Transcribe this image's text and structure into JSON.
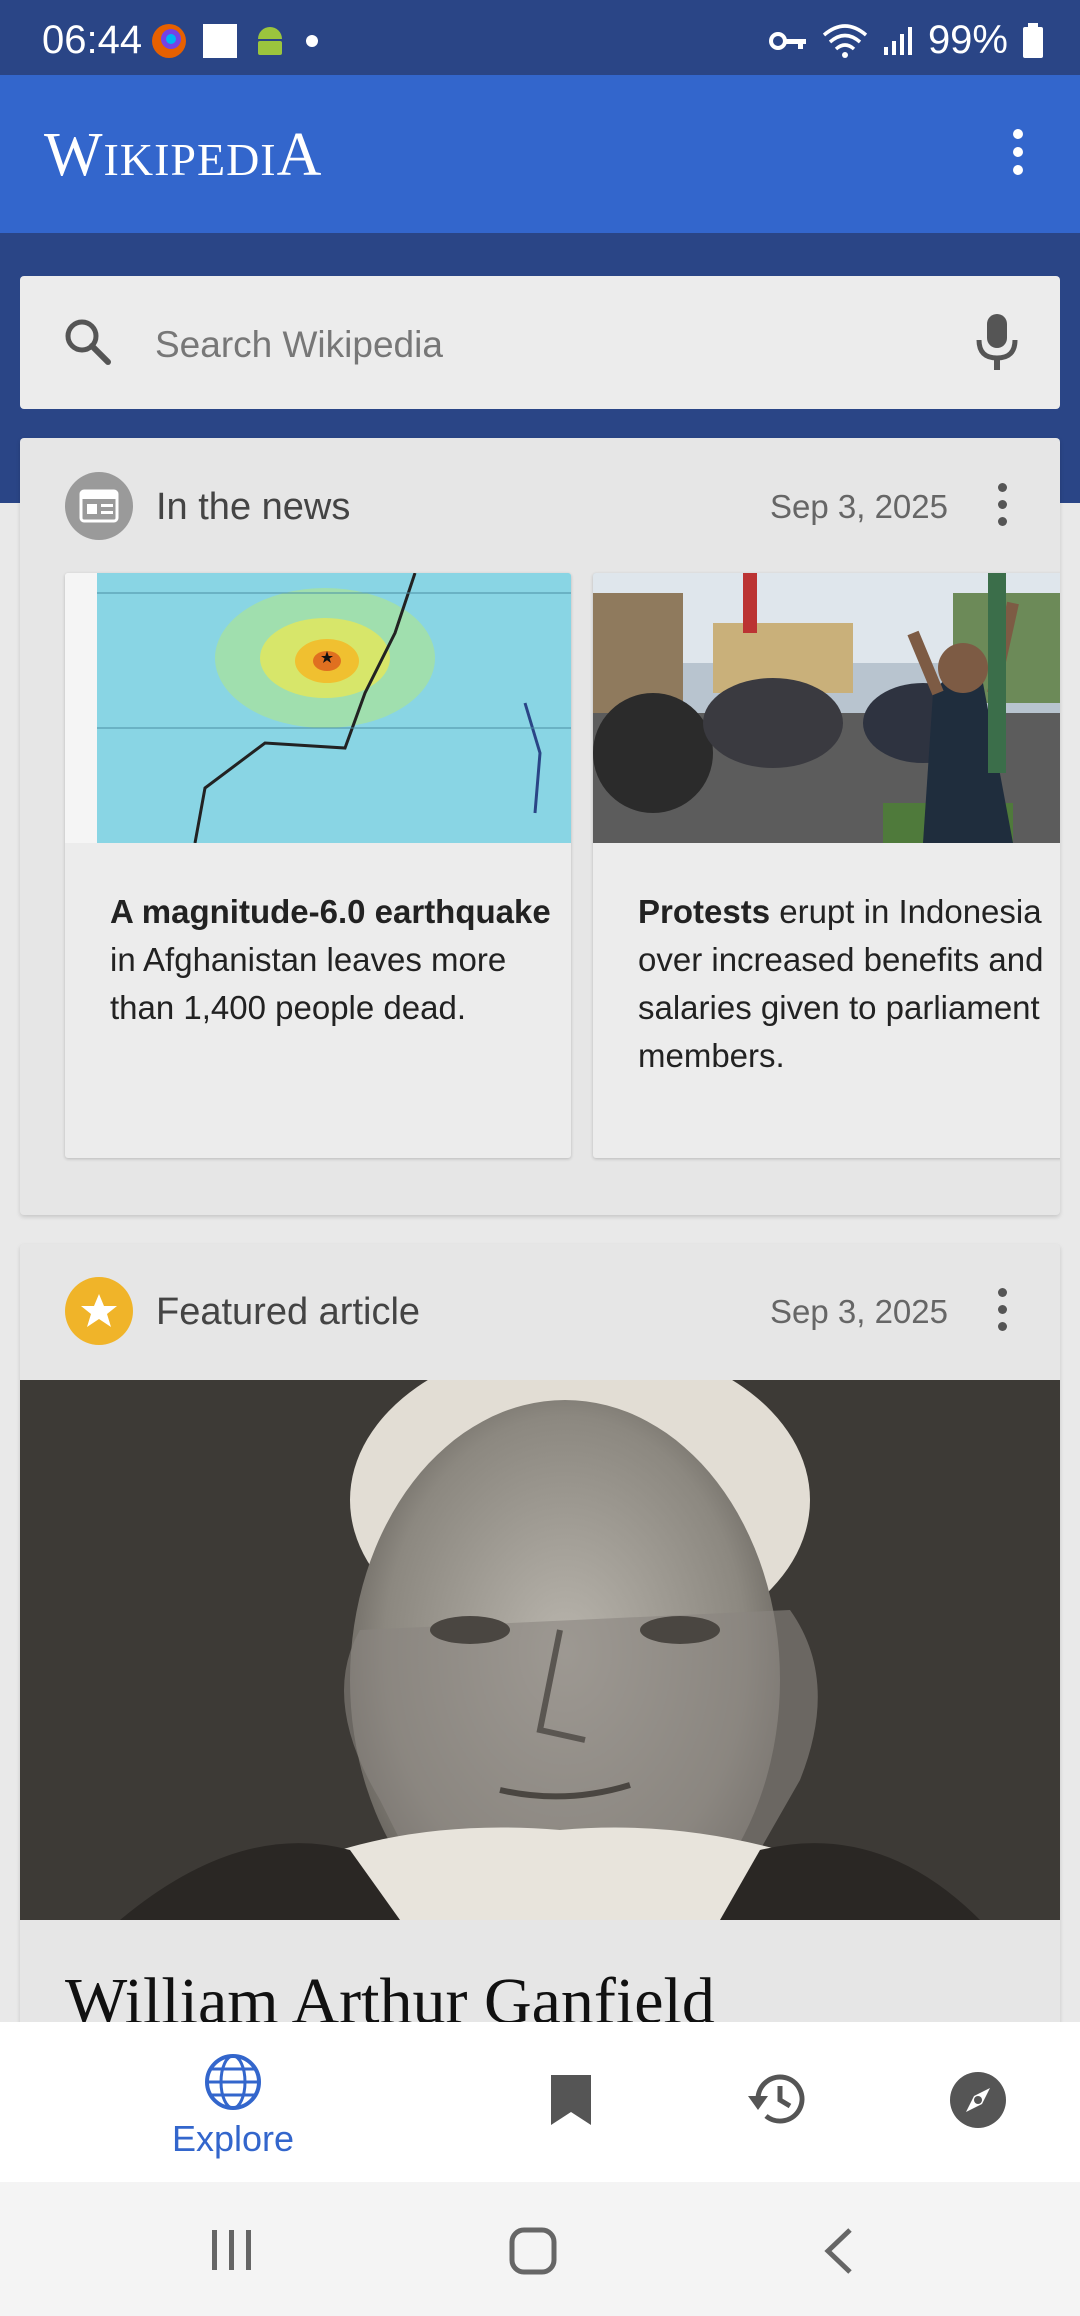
{
  "status_bar": {
    "time": "06:44",
    "battery": "99%",
    "left_icons": [
      "firefox-icon",
      "square-icon",
      "android-icon",
      "dot-icon"
    ],
    "right_icons": [
      "vpn-key-icon",
      "wifi-icon",
      "signal-icon",
      "battery-icon"
    ]
  },
  "app_bar": {
    "title_parts": [
      "W",
      "IKIPEDI",
      "A"
    ],
    "menu_icon": "more-vert-icon"
  },
  "search": {
    "placeholder": "Search Wikipedia",
    "icons": [
      "search-icon",
      "mic-icon"
    ]
  },
  "news_card": {
    "title": "In the news",
    "date": "Sep 3, 2025",
    "icon": "newspaper-icon",
    "items": [
      {
        "bold": "A magnitude-6.0 earthquake",
        "rest": " in Afghanistan leaves more than 1,400 people dead.",
        "image": "earthquake-map-image"
      },
      {
        "bold": "Protests",
        "rest": " erupt in Indonesia over increased benefits and salaries given to parliament members.",
        "image": "protest-photo-image"
      }
    ]
  },
  "featured_card": {
    "title": "Featured article",
    "date": "Sep 3, 2025",
    "icon": "star-icon",
    "article_title": "William Arthur Ganfield",
    "image": "portrait-photo-image"
  },
  "bottom_nav": {
    "items": [
      {
        "label": "Explore",
        "icon": "globe-icon",
        "active": true
      },
      {
        "label": "",
        "icon": "bookmark-icon",
        "active": false
      },
      {
        "label": "",
        "icon": "history-icon",
        "active": false
      },
      {
        "label": "",
        "icon": "compass-icon",
        "active": false
      }
    ]
  },
  "system_nav": [
    "recents-icon",
    "home-icon",
    "back-icon"
  ],
  "colors": {
    "brand_blue": "#3366cc",
    "status_bar": "#2a4586",
    "featured_star": "#f0b429"
  }
}
